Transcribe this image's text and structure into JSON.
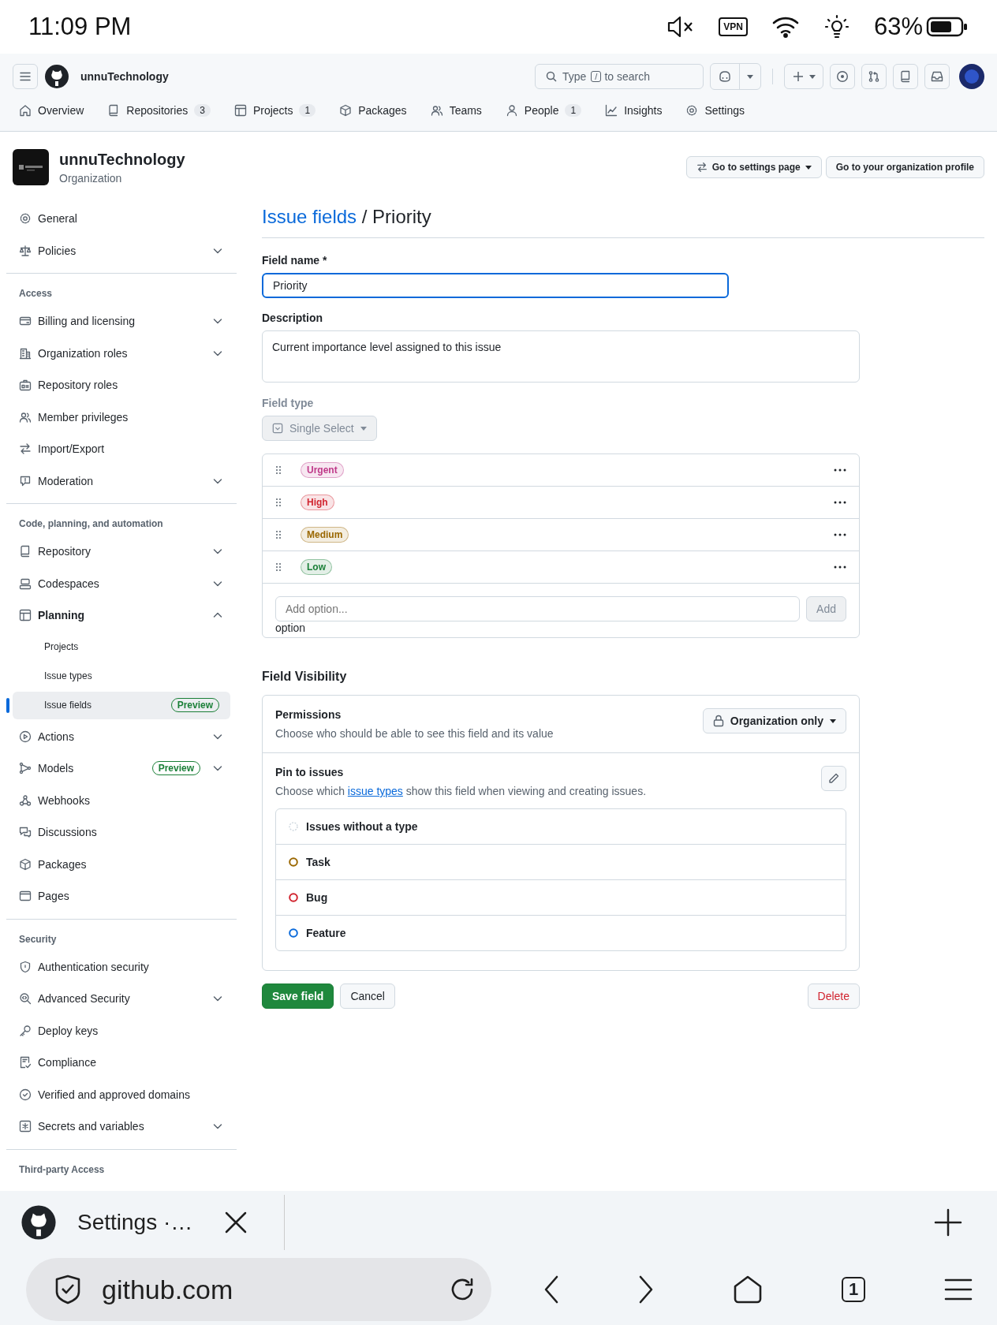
{
  "status_bar": {
    "time": "11:09 PM",
    "vpn": "VPN",
    "battery": "63%"
  },
  "header": {
    "org": "unnuTechnology",
    "search": {
      "before": "Type",
      "key": "/",
      "after": "to search"
    }
  },
  "nav": [
    {
      "label": "Overview"
    },
    {
      "label": "Repositories",
      "count": "3"
    },
    {
      "label": "Projects",
      "count": "1"
    },
    {
      "label": "Packages"
    },
    {
      "label": "Teams"
    },
    {
      "label": "People",
      "count": "1"
    },
    {
      "label": "Insights"
    },
    {
      "label": "Settings"
    }
  ],
  "org": {
    "name": "unnuTechnology",
    "type": "Organization"
  },
  "actions": [
    {
      "label": "Go to settings page",
      "kind": "menu"
    },
    {
      "label": "Go to your organization profile",
      "kind": "plain"
    }
  ],
  "sidebar": {
    "sections": [
      {
        "items": [
          {
            "label": "General",
            "kind": "link",
            "selected": false
          },
          {
            "label": "Policies",
            "kind": "group",
            "expanded": false,
            "selected": false
          }
        ]
      },
      {
        "heading": "Access",
        "items": [
          {
            "label": "Billing and licensing",
            "kind": "group",
            "expanded": false,
            "selected": false
          },
          {
            "label": "Organization roles",
            "kind": "group",
            "expanded": false,
            "selected": false
          },
          {
            "label": "Repository roles",
            "kind": "link",
            "selected": false
          },
          {
            "label": "Member privileges",
            "kind": "link",
            "selected": false
          },
          {
            "label": "Import/Export",
            "kind": "link",
            "selected": false
          },
          {
            "label": "Moderation",
            "kind": "group",
            "expanded": false,
            "selected": false
          }
        ]
      },
      {
        "heading": "Code, planning, and automation",
        "items": [
          {
            "label": "Repository",
            "kind": "group",
            "expanded": false,
            "selected": false
          },
          {
            "label": "Codespaces",
            "kind": "group",
            "expanded": false,
            "selected": false
          },
          {
            "label": "Planning",
            "kind": "group",
            "expanded": true,
            "selected": false,
            "children": [
              {
                "label": "Projects",
                "selected": false
              },
              {
                "label": "Issue types",
                "selected": false
              },
              {
                "label": "Issue fields",
                "selected": true,
                "badge": "Preview"
              }
            ]
          },
          {
            "label": "Actions",
            "kind": "group",
            "expanded": false,
            "selected": false
          },
          {
            "label": "Models",
            "kind": "group",
            "expanded": false,
            "selected": false,
            "badge": "Preview"
          },
          {
            "label": "Webhooks",
            "kind": "link",
            "selected": false
          },
          {
            "label": "Discussions",
            "kind": "link",
            "selected": false
          },
          {
            "label": "Packages",
            "kind": "link",
            "selected": false
          },
          {
            "label": "Pages",
            "kind": "link",
            "selected": false
          }
        ]
      },
      {
        "heading": "Security",
        "items": [
          {
            "label": "Authentication security",
            "kind": "link",
            "selected": false
          },
          {
            "label": "Advanced Security",
            "kind": "group",
            "expanded": false,
            "selected": false
          },
          {
            "label": "Deploy keys",
            "kind": "link",
            "selected": false
          },
          {
            "label": "Compliance",
            "kind": "link",
            "selected": false
          },
          {
            "label": "Verified and approved domains",
            "kind": "link",
            "selected": false
          },
          {
            "label": "Secrets and variables",
            "kind": "group",
            "expanded": false,
            "selected": false
          }
        ]
      },
      {
        "heading": "Third-party Access"
      }
    ]
  },
  "page": {
    "breadcrumb": "Issue fields",
    "separator": "/",
    "title": "Priority"
  },
  "form": {
    "name_label": "Field name *",
    "name_value": "Priority",
    "description_label": "Description",
    "description_value": "Current importance level assigned to this issue",
    "type_label": "Field type",
    "type_value": "Single Select",
    "type_disabled": true,
    "options": [
      {
        "label": "Urgent",
        "color": "#bf3989"
      },
      {
        "label": "High",
        "color": "#d1242f"
      },
      {
        "label": "Medium",
        "color": "#9a6700"
      },
      {
        "label": "Low",
        "color": "#1a7f37"
      }
    ],
    "add_placeholder": "Add option...",
    "add_button": "Add",
    "add_disabled": true,
    "stray_text": "option"
  },
  "visibility": {
    "heading": "Field Visibility",
    "permissions_title": "Permissions",
    "permissions_description": "Choose who should be able to see this field and its value",
    "permissions_value": "Organization only",
    "pin_title": "Pin to issues",
    "pin_before": "Choose which",
    "pin_link": "issue types",
    "pin_after": "show this field when viewing and creating issues.",
    "types": [
      {
        "label": "Issues without a type",
        "kind": "untyped",
        "color": "#d1d9e0"
      },
      {
        "label": "Task",
        "kind": "typed",
        "color": "#9a6700"
      },
      {
        "label": "Bug",
        "kind": "typed",
        "color": "#d1242f"
      },
      {
        "label": "Feature",
        "kind": "typed",
        "color": "#0969da"
      }
    ]
  },
  "buttons": {
    "save": "Save field",
    "cancel": "Cancel",
    "delete": "Delete"
  },
  "browser": {
    "tab_title": "Settings ·…",
    "url": "github.com",
    "tab_count": "1"
  }
}
